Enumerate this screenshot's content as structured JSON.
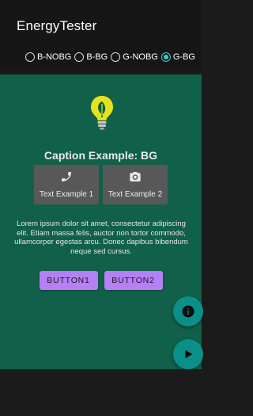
{
  "app": {
    "title": "EnergyTester"
  },
  "radios": [
    {
      "label": "B-NOBG",
      "selected": false
    },
    {
      "label": "B-BG",
      "selected": false
    },
    {
      "label": "G-NOBG",
      "selected": false
    },
    {
      "label": "G-BG",
      "selected": true
    }
  ],
  "main": {
    "caption": "Caption Example: BG",
    "tiles": [
      {
        "icon": "phone-icon",
        "label": "Text Example 1"
      },
      {
        "icon": "camera-icon",
        "label": "Text Example 2"
      }
    ],
    "body_text": "Lorem ipsum dolor sit amet, consectetur adipiscing elit. Etiam massa felis, auctor non tortor commodo, ullamcorper egestas arcu. Donec dapibus bibendum neque sed cursus.",
    "buttons": [
      {
        "label": "BUTTON1"
      },
      {
        "label": "BUTTON2"
      }
    ]
  },
  "fabs": [
    {
      "icon": "info-icon"
    },
    {
      "icon": "play-icon"
    }
  ],
  "colors": {
    "background": "#11604a",
    "accent": "#39d0c5",
    "button": "#b57ff6",
    "fab": "#0b8f89",
    "tile": "#585858"
  }
}
